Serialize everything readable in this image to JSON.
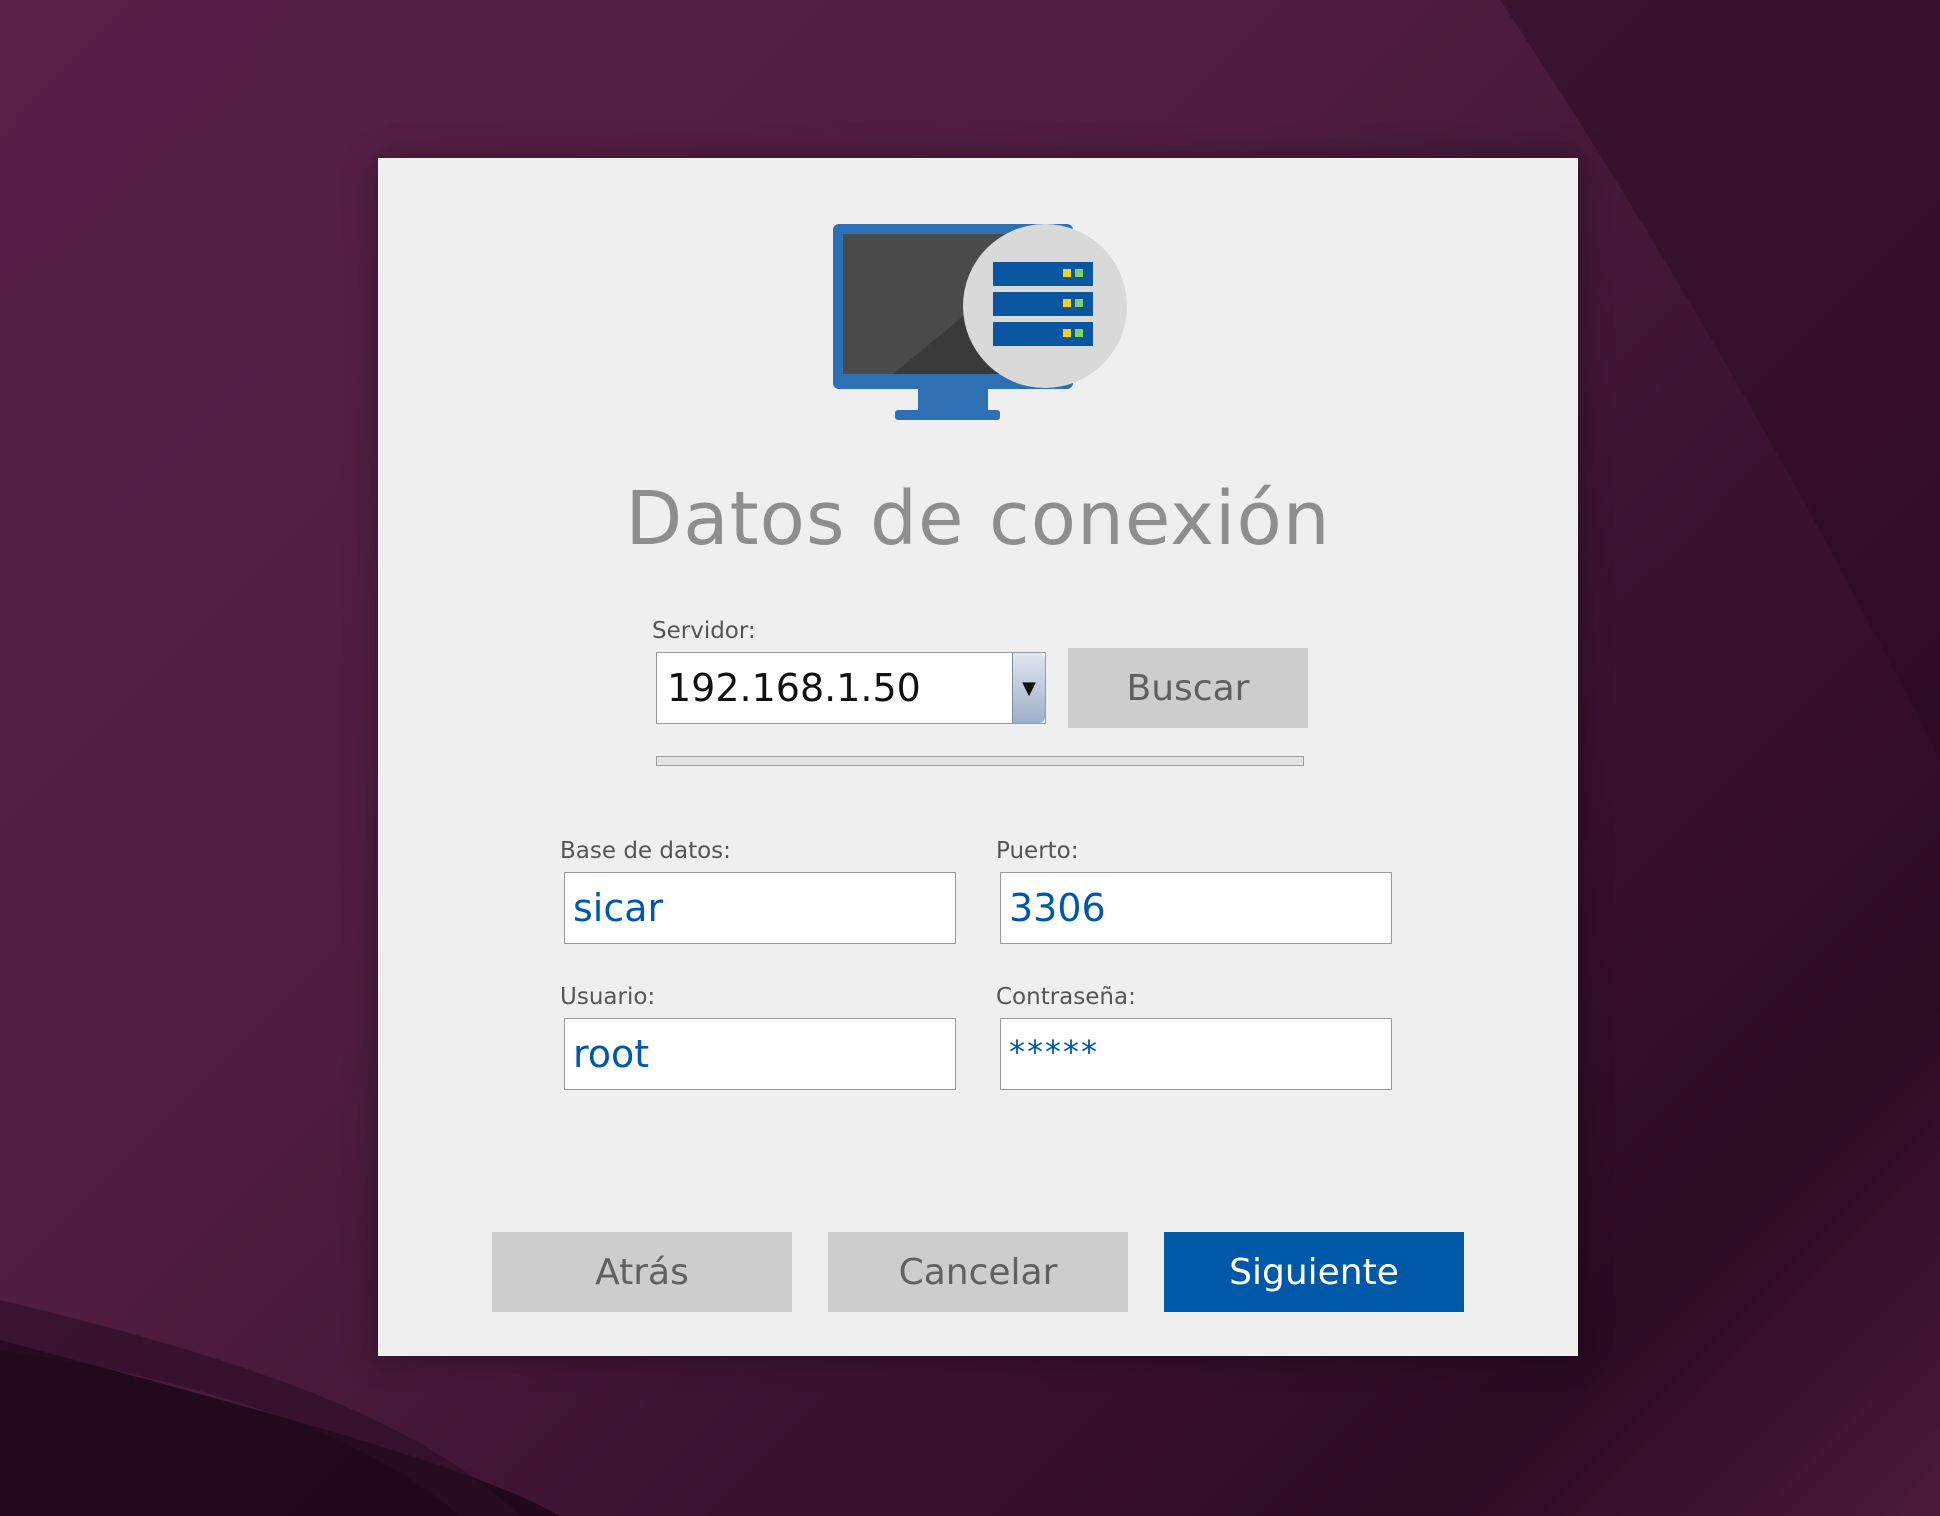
{
  "dialog": {
    "title": "Datos de conexión",
    "logo_icon": "monitor-server-icon",
    "server": {
      "label": "Servidor:",
      "value": "192.168.1.50",
      "dropdown_icon": "▼"
    },
    "search_button": "Buscar",
    "database": {
      "label": "Base de datos:",
      "value": "sicar"
    },
    "port": {
      "label": "Puerto:",
      "value": "3306"
    },
    "user": {
      "label": "Usuario:",
      "value": "root"
    },
    "password": {
      "label": "Contraseña:",
      "value": "*****"
    },
    "buttons": {
      "back": "Atrás",
      "cancel": "Cancelar",
      "next": "Siguiente"
    }
  },
  "colors": {
    "primary": "#0058a8",
    "dialog_bg": "#efefef",
    "button_gray": "#cdcdcd",
    "desktop": "#4e1d3f"
  }
}
